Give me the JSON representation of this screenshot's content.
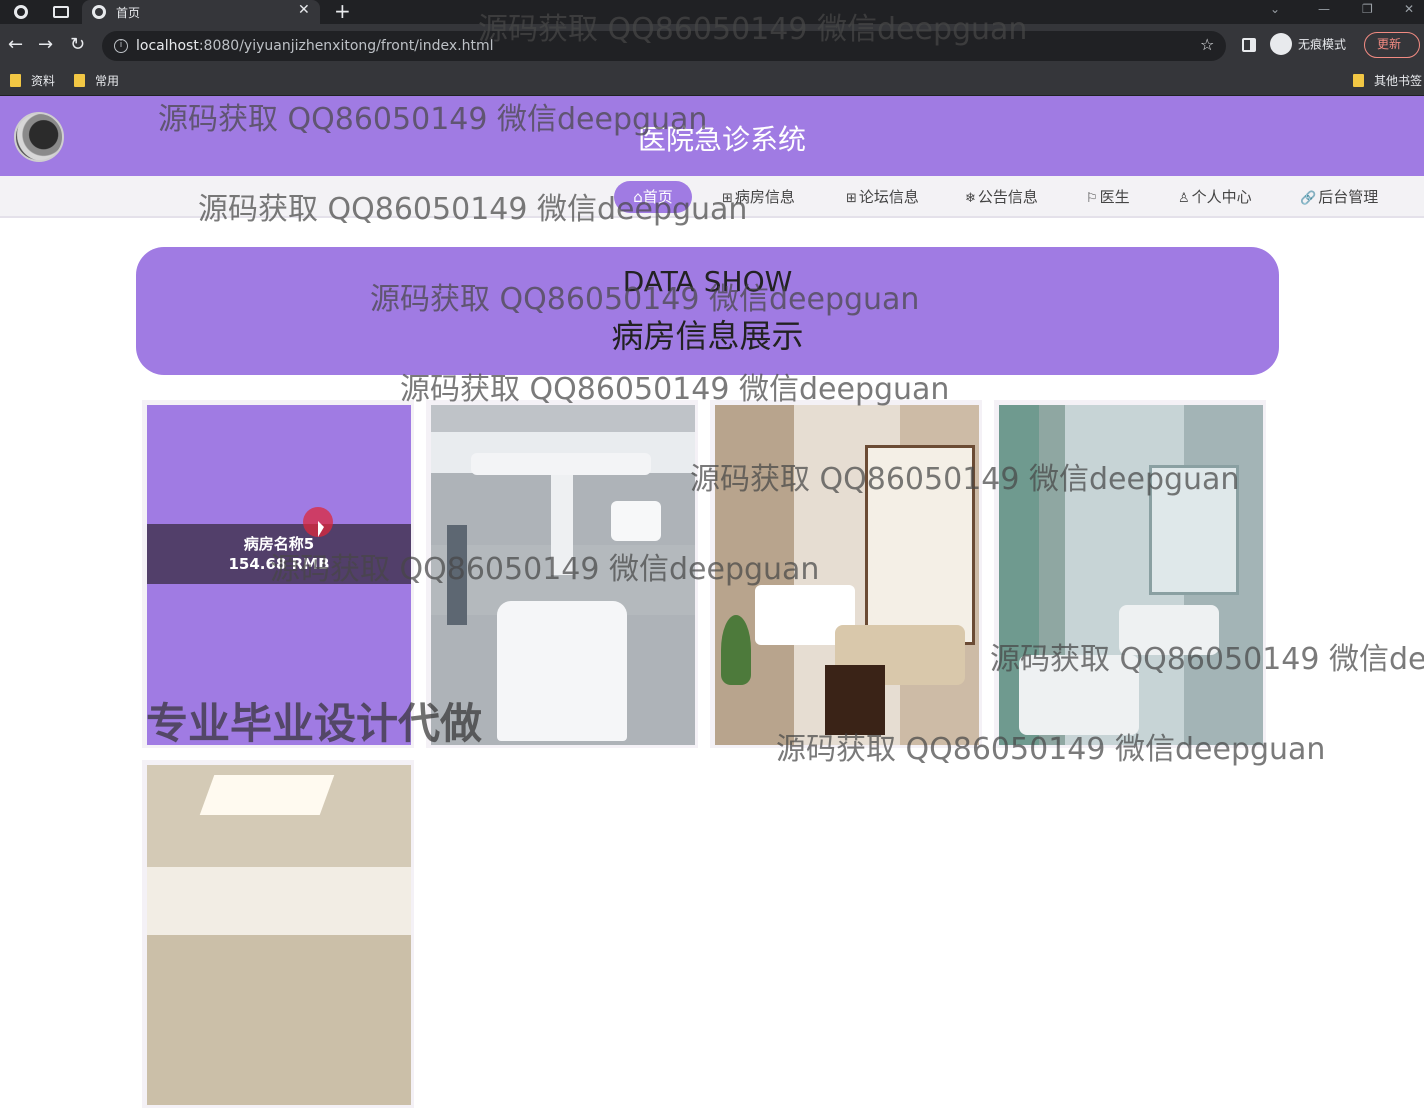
{
  "browser": {
    "tab_title": "首页",
    "url_host": "localhost",
    "url_rest": ":8080/yiyuanjizhenxitong/front/index.html",
    "incognito_label": "无痕模式",
    "update_label": "更新",
    "bookmarks": [
      "资料",
      "常用"
    ],
    "bookmarks_right": "其他书签"
  },
  "site": {
    "title": "医院急诊系统",
    "nav": [
      {
        "label": "首页",
        "icon": "⌂"
      },
      {
        "label": "病房信息",
        "icon": "⊞"
      },
      {
        "label": "论坛信息",
        "icon": "⊞"
      },
      {
        "label": "公告信息",
        "icon": "❄"
      },
      {
        "label": "医生",
        "icon": "⚐"
      },
      {
        "label": "个人中心",
        "icon": "♙"
      },
      {
        "label": "后台管理",
        "icon": "🔗"
      }
    ]
  },
  "section": {
    "title_en": "DATA SHOW",
    "title_zh": "病房信息展示"
  },
  "cards": [
    {
      "name": "病房名称5",
      "price": "154.68 RMB"
    }
  ],
  "watermarks": {
    "qq": "源码获取 QQ86050149 微信deepguan",
    "qq_cut": "源码获取 QQ86050149 微信dee",
    "big": "专业毕业设计代做"
  }
}
